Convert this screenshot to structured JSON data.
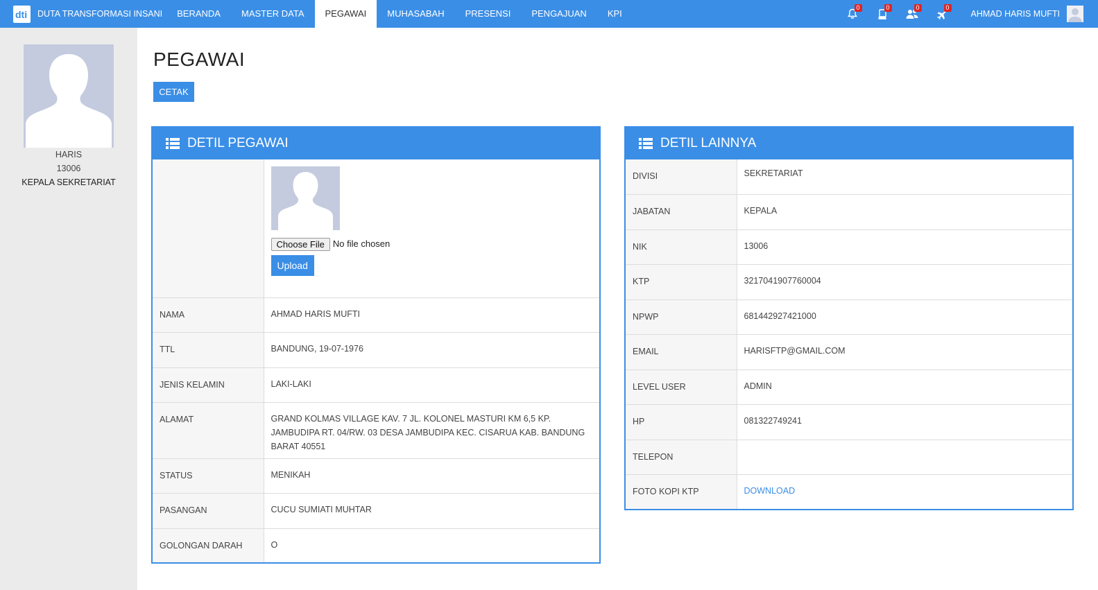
{
  "brand": {
    "name": "DUTA TRANSFORMASI INSANI",
    "logo_text": "dti"
  },
  "nav": {
    "items": [
      {
        "label": "BERANDA"
      },
      {
        "label": "MASTER DATA"
      },
      {
        "label": "PEGAWAI",
        "active": true
      },
      {
        "label": "MUHASABAH"
      },
      {
        "label": "PRESENSI"
      },
      {
        "label": "PENGAJUAN"
      },
      {
        "label": "KPI"
      }
    ],
    "notifications": [
      {
        "icon": "bell-icon",
        "count": "0"
      },
      {
        "icon": "book-icon",
        "count": "0"
      },
      {
        "icon": "users-icon",
        "count": "0"
      },
      {
        "icon": "plane-icon",
        "count": "0"
      }
    ],
    "user_name": "AHMAD HARIS MUFTI"
  },
  "sidebar": {
    "name": "HARIS",
    "nik": "13006",
    "position": "KEPALA SEKRETARIAT"
  },
  "page": {
    "title": "PEGAWAI",
    "print_label": "CETAK"
  },
  "detail_pegawai": {
    "title": "DETIL PEGAWAI",
    "photo": {
      "choose_label": "Choose File",
      "status": "No file chosen",
      "upload_label": "Upload"
    },
    "rows": [
      {
        "label": "NAMA",
        "value": "AHMAD HARIS MUFTI"
      },
      {
        "label": "TTL",
        "value": "BANDUNG, 19-07-1976"
      },
      {
        "label": "JENIS KELAMIN",
        "value": "LAKI-LAKI"
      },
      {
        "label": "ALAMAT",
        "value": "GRAND KOLMAS VILLAGE KAV. 7 JL. KOLONEL MASTURI KM 6,5 KP. JAMBUDIPA RT. 04/RW. 03 DESA JAMBUDIPA KEC. CISARUA KAB. BANDUNG BARAT 40551"
      },
      {
        "label": "STATUS",
        "value": "MENIKAH"
      },
      {
        "label": "PASANGAN",
        "value": "CUCU SUMIATI MUHTAR"
      },
      {
        "label": "GOLONGAN DARAH",
        "value": "O"
      }
    ]
  },
  "detail_lainnya": {
    "title": "DETIL LAINNYA",
    "rows": [
      {
        "label": "DIVISI",
        "value": "SEKRETARIAT"
      },
      {
        "label": "JABATAN",
        "value": "KEPALA"
      },
      {
        "label": "NIK",
        "value": "13006"
      },
      {
        "label": "KTP",
        "value": "3217041907760004"
      },
      {
        "label": "NPWP",
        "value": "681442927421000"
      },
      {
        "label": "EMAIL",
        "value": "HARISFTP@GMAIL.COM"
      },
      {
        "label": "LEVEL USER",
        "value": "ADMIN"
      },
      {
        "label": "HP",
        "value": "081322749241"
      },
      {
        "label": "TELEPON",
        "value": ""
      },
      {
        "label": "FOTO KOPI KTP",
        "value": "DOWNLOAD",
        "link": true
      }
    ]
  },
  "colors": {
    "primary": "#3a8ee6",
    "badge": "#e02424",
    "sidebar_bg": "#ebebeb",
    "avatar_bg": "#c4cbdf"
  }
}
